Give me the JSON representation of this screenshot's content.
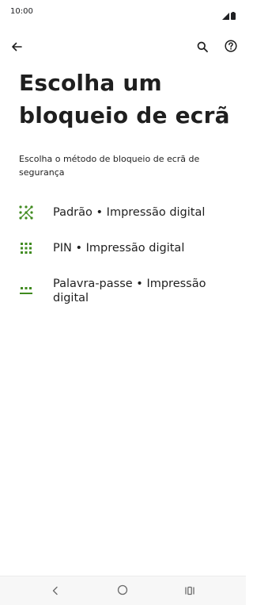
{
  "status_bar": {
    "time": "10:00",
    "icons": [
      "signal-icon",
      "battery-icon"
    ]
  },
  "app_bar": {
    "back_icon": "back-arrow-icon",
    "search_icon": "search-icon",
    "help_icon": "help-icon"
  },
  "page": {
    "title": "Escolha um bloqueio de ecrã",
    "description": "Escolha o método de bloqueio de ecrã de segurança"
  },
  "options": [
    {
      "label": "Padrão • Impressão digital",
      "icon": "pattern-icon"
    },
    {
      "label": "PIN • Impressão digital",
      "icon": "pin-icon"
    },
    {
      "label": "Palavra-passe • Impressão digital",
      "icon": "password-icon"
    }
  ],
  "nav_bar": {
    "icons": [
      "back-icon",
      "home-icon",
      "recent-apps-icon"
    ]
  },
  "colors": {
    "accent": "#3f8a1f",
    "text": "#1f1f1f",
    "nav_background": "#f7f7f7"
  }
}
